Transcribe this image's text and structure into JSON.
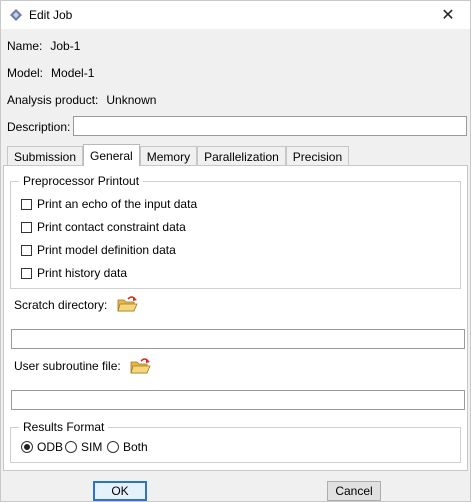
{
  "window": {
    "title": "Edit Job",
    "close_glyph": "✕"
  },
  "fields": {
    "name_label": "Name:",
    "name_value": "Job-1",
    "model_label": "Model:",
    "model_value": "Model-1",
    "product_label": "Analysis product:",
    "product_value": "Unknown",
    "description_label": "Description:",
    "description_value": ""
  },
  "tabs": [
    {
      "label": "Submission",
      "active": false
    },
    {
      "label": "General",
      "active": true
    },
    {
      "label": "Memory",
      "active": false
    },
    {
      "label": "Parallelization",
      "active": false
    },
    {
      "label": "Precision",
      "active": false
    }
  ],
  "preprocessor": {
    "title": "Preprocessor Printout",
    "options": [
      {
        "label": "Print an echo of the input data",
        "checked": false
      },
      {
        "label": "Print contact constraint data",
        "checked": false
      },
      {
        "label": "Print model definition data",
        "checked": false
      },
      {
        "label": "Print history data",
        "checked": false
      }
    ]
  },
  "scratch": {
    "label": "Scratch directory:",
    "value": ""
  },
  "user_subroutine": {
    "label": "User subroutine file:",
    "value": ""
  },
  "results_format": {
    "title": "Results Format",
    "options": [
      {
        "label": "ODB",
        "selected": true
      },
      {
        "label": "SIM",
        "selected": false
      },
      {
        "label": "Both",
        "selected": false
      }
    ]
  },
  "buttons": {
    "ok": "OK",
    "cancel": "Cancel"
  },
  "icons": {
    "title": "abaqus-job-icon",
    "folder": "open-folder-icon"
  },
  "colors": {
    "default_button_border": "#2b74c7",
    "folder_yellow": "#f2c14e",
    "folder_arrow": "#d9281e"
  }
}
